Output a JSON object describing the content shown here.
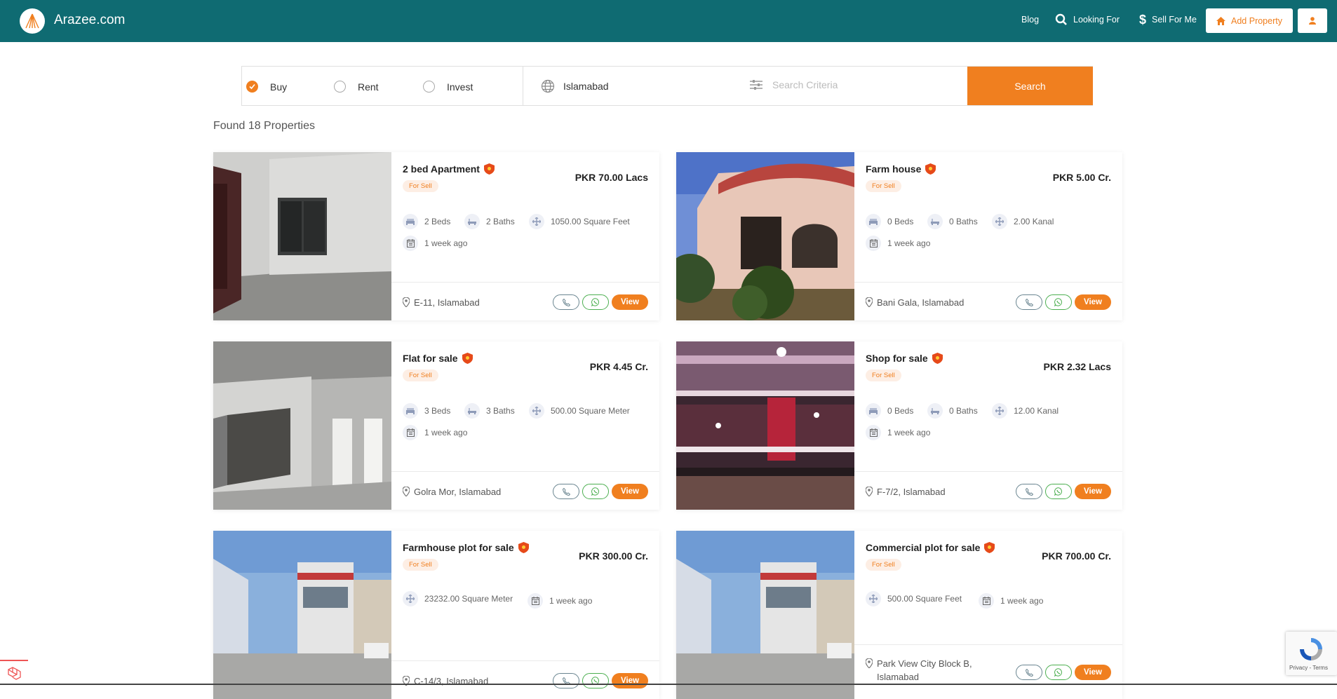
{
  "header": {
    "brand": "Arazee.com",
    "nav": {
      "blog": "Blog",
      "looking_for": "Looking For",
      "sell_for_me": "Sell For Me",
      "add_property": "Add Property"
    }
  },
  "search": {
    "options": [
      "Buy",
      "Rent",
      "Invest"
    ],
    "selected": "Buy",
    "city": "Islamabad",
    "criteria_placeholder": "Search Criteria",
    "button": "Search"
  },
  "results": {
    "found_text": "Found 18 Properties"
  },
  "listings": [
    {
      "title": "2 bed Apartment",
      "badge": "For Sell",
      "price": "PKR 70.00 Lacs",
      "beds": "2 Beds",
      "baths": "2 Baths",
      "area": "1050.00 Square Feet",
      "posted": "1 week ago",
      "location": "E-11, Islamabad",
      "view": "View"
    },
    {
      "title": "Farm house",
      "badge": "For Sell",
      "price": "PKR 5.00 Cr.",
      "beds": "0 Beds",
      "baths": "0 Baths",
      "area": "2.00 Kanal",
      "posted": "1 week ago",
      "location": "Bani Gala, Islamabad",
      "view": "View"
    },
    {
      "title": "Flat for sale",
      "badge": "For Sell",
      "price": "PKR 4.45 Cr.",
      "beds": "3 Beds",
      "baths": "3 Baths",
      "area": "500.00 Square Meter",
      "posted": "1 week ago",
      "location": "Golra Mor, Islamabad",
      "view": "View"
    },
    {
      "title": "Shop for sale",
      "badge": "For Sell",
      "price": "PKR 2.32 Lacs",
      "beds": "0 Beds",
      "baths": "0 Baths",
      "area": "12.00 Kanal",
      "posted": "1 week ago",
      "location": "F-7/2, Islamabad",
      "view": "View"
    },
    {
      "title": "Farmhouse plot for sale",
      "badge": "For Sell",
      "price": "PKR 300.00 Cr.",
      "area": "23232.00 Square Meter",
      "posted": "1 week ago",
      "location": "C-14/3, Islamabad",
      "view": "View"
    },
    {
      "title": "Commercial plot for sale",
      "badge": "For Sell",
      "price": "PKR 700.00 Cr.",
      "area": "500.00 Square Feet",
      "posted": "1 week ago",
      "location": "Park View City Block B, Islamabad",
      "view": "View"
    }
  ],
  "recaptcha": {
    "links": "Privacy - Terms"
  },
  "colors": {
    "header": "#0f6b72",
    "accent": "#f07f1f"
  }
}
